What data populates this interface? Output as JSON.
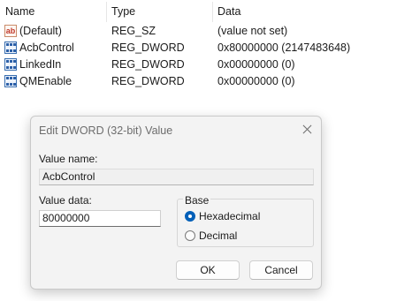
{
  "columns": {
    "name": "Name",
    "type": "Type",
    "data": "Data"
  },
  "rows": [
    {
      "icon": "string-value-icon",
      "icon_text": "ab",
      "name": "(Default)",
      "type": "REG_SZ",
      "data": "(value not set)"
    },
    {
      "icon": "dword-value-icon",
      "name": "AcbControl",
      "type": "REG_DWORD",
      "data": "0x80000000 (2147483648)"
    },
    {
      "icon": "dword-value-icon",
      "name": "LinkedIn",
      "type": "REG_DWORD",
      "data": "0x00000000 (0)"
    },
    {
      "icon": "dword-value-icon",
      "name": "QMEnable",
      "type": "REG_DWORD",
      "data": "0x00000000 (0)"
    }
  ],
  "dialog": {
    "title": "Edit DWORD (32-bit) Value",
    "value_name_label": "Value name:",
    "value_name": "AcbControl",
    "value_data_label": "Value data:",
    "value_data": "80000000",
    "base_label": "Base",
    "base_options": [
      {
        "label": "Hexadecimal",
        "selected": true
      },
      {
        "label": "Decimal",
        "selected": false
      }
    ],
    "ok_label": "OK",
    "cancel_label": "Cancel"
  },
  "colors": {
    "accent": "#005fb8",
    "dialog_bg": "#f3f3f3",
    "title_text": "#6d6d6d"
  }
}
